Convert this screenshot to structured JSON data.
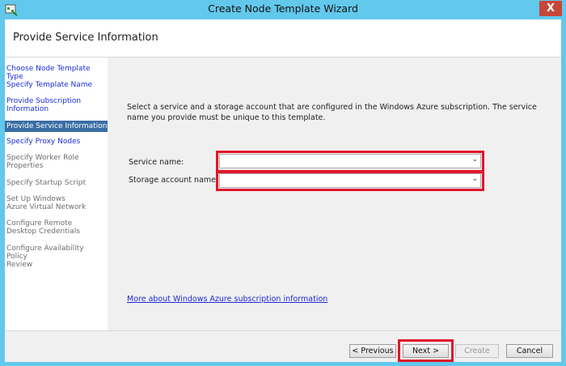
{
  "window": {
    "title": "Create Node Template Wizard",
    "close": "X"
  },
  "header": {
    "title": "Provide Service Information"
  },
  "sidebar": {
    "items": [
      {
        "label": "Choose Node Template Type"
      },
      {
        "label": "Specify Template Name"
      },
      {
        "label": "Provide Subscription Information"
      },
      {
        "label": "Provide Service Information"
      },
      {
        "label": "Specify Proxy Nodes"
      },
      {
        "label": "Specify Worker Role Properties"
      },
      {
        "label": "Specify Startup Script"
      },
      {
        "label": "Set Up Windows Azure Virtual Network"
      },
      {
        "label": "Configure Remote Desktop Credentials"
      },
      {
        "label": "Configure Availability Policy"
      },
      {
        "label": "Review"
      }
    ]
  },
  "main": {
    "instructions": "Select a service and a storage account that are configured in the Windows Azure subscription. The service name you provide must be unique to this template.",
    "service_name_label": "Service name:",
    "service_name_value": "",
    "storage_account_label": "Storage account name:",
    "storage_account_value": "",
    "more_link": "More about Windows Azure subscription information"
  },
  "footer": {
    "previous": "< Previous",
    "next": "Next >",
    "create": "Create",
    "cancel": "Cancel"
  },
  "colors": {
    "highlight": "#e0162b",
    "link": "#1a2bd6",
    "active": "#3a6ea5",
    "frame": "#62c8ec"
  }
}
